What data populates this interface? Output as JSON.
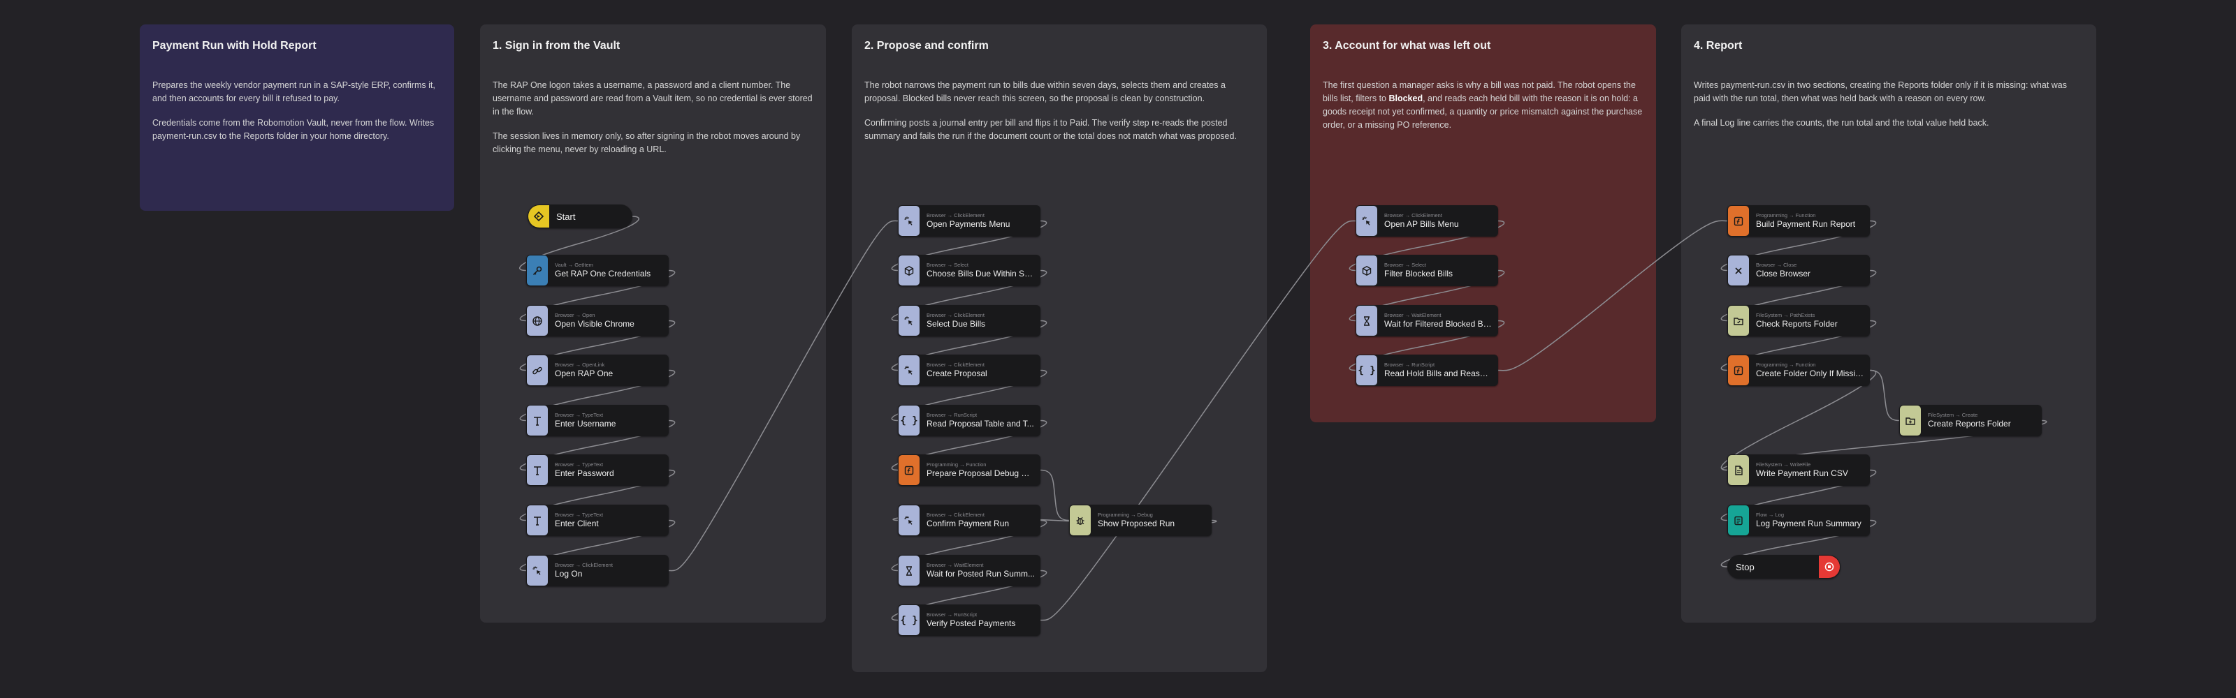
{
  "panels": {
    "intro": {
      "title": "Payment Run with Hold Report",
      "p1": "Prepares the weekly vendor payment run in a SAP-style ERP, confirms it, and then accounts for every bill it refused to pay.",
      "p2": "Credentials come from the Robomotion Vault, never from the flow. Writes payment-run.csv to the Reports folder in your home directory."
    },
    "sign_in": {
      "title": "1. Sign in from the Vault",
      "p1": "The RAP One logon takes a username, a password and a client number. The username and password are read from a Vault item, so no credential is ever stored in the flow.",
      "p2": "The session lives in memory only, so after signing in the robot moves around by clicking the menu, never by reloading a URL."
    },
    "propose": {
      "title": "2. Propose and confirm",
      "p1": "The robot narrows the payment run to bills due within seven days, selects them and creates a proposal. Blocked bills never reach this screen, so the proposal is clean by construction.",
      "p2": "Confirming posts a journal entry per bill and flips it to Paid. The verify step re-reads the posted summary and fails the run if the document count or the total does not match what was proposed."
    },
    "account": {
      "title": "3. Account for what was left out",
      "p1_a": "The first question a manager asks is why a bill was not paid. The robot opens the bills list, filters to ",
      "p1_b": "Blocked",
      "p1_c": ", and reads each held bill with the reason it is on hold: a goods receipt not yet confirmed, a quantity or price mismatch against the purchase order, or a missing PO reference."
    },
    "report": {
      "title": "4. Report",
      "p1": "Writes payment-run.csv in two sections, creating the Reports folder only if it is missing: what was paid with the run total, then what was held back with a reason on every row.",
      "p2": "A final Log line carries the counts, the run total and the total value held back."
    }
  },
  "nodes": {
    "start": {
      "title": "Start",
      "icon": "start-icon"
    },
    "get_creds": {
      "sub": "Vault → GetItem",
      "title": "Get RAP One Credentials",
      "icon": "key-icon"
    },
    "open_chrome": {
      "sub": "Browser → Open",
      "title": "Open Visible Chrome",
      "icon": "globe-icon"
    },
    "open_rap": {
      "sub": "Browser → OpenLink",
      "title": "Open RAP One",
      "icon": "link-icon"
    },
    "enter_user": {
      "sub": "Browser → TypeText",
      "title": "Enter Username",
      "icon": "text-icon"
    },
    "enter_pass": {
      "sub": "Browser → TypeText",
      "title": "Enter Password",
      "icon": "text-icon"
    },
    "enter_client": {
      "sub": "Browser → TypeText",
      "title": "Enter Client",
      "icon": "text-icon"
    },
    "log_on": {
      "sub": "Browser → ClickElement",
      "title": "Log On",
      "icon": "click-icon"
    },
    "open_pay_menu": {
      "sub": "Browser → ClickElement",
      "title": "Open Payments Menu",
      "icon": "click-icon"
    },
    "choose_bills": {
      "sub": "Browser → Select",
      "title": "Choose Bills Due Within Se...",
      "icon": "cube-icon"
    },
    "select_due": {
      "sub": "Browser → ClickElement",
      "title": "Select Due Bills",
      "icon": "click-icon"
    },
    "create_proposal": {
      "sub": "Browser → ClickElement",
      "title": "Create Proposal",
      "icon": "click-icon"
    },
    "read_proposal": {
      "sub": "Browser → RunScript",
      "title": "Read Proposal Table and T...",
      "icon": "braces-icon"
    },
    "prep_debug": {
      "sub": "Programming → Function",
      "title": "Prepare Proposal Debug Data",
      "icon": "function-icon"
    },
    "confirm_run": {
      "sub": "Browser → ClickElement",
      "title": "Confirm Payment Run",
      "icon": "click-icon"
    },
    "wait_posted": {
      "sub": "Browser → WaitElement",
      "title": "Wait for Posted Run Summ...",
      "icon": "hourglass-icon"
    },
    "verify_posted": {
      "sub": "Browser → RunScript",
      "title": "Verify Posted Payments",
      "icon": "braces-icon"
    },
    "show_proposed": {
      "sub": "Programming → Debug",
      "title": "Show Proposed Run",
      "icon": "bug-icon"
    },
    "open_ap": {
      "sub": "Browser → ClickElement",
      "title": "Open AP Bills Menu",
      "icon": "click-icon"
    },
    "filter_blocked": {
      "sub": "Browser → Select",
      "title": "Filter Blocked Bills",
      "icon": "cube-icon"
    },
    "wait_filtered": {
      "sub": "Browser → WaitElement",
      "title": "Wait for Filtered Blocked Bills",
      "icon": "hourglass-icon"
    },
    "read_hold": {
      "sub": "Browser → RunScript",
      "title": "Read Hold Bills and Reasons",
      "icon": "braces-icon"
    },
    "build_report": {
      "sub": "Programming → Function",
      "title": "Build Payment Run Report",
      "icon": "function-icon"
    },
    "close_browser": {
      "sub": "Browser → Close",
      "title": "Close Browser",
      "icon": "close-icon"
    },
    "check_folder": {
      "sub": "FileSystem → PathExists",
      "title": "Check Reports Folder",
      "icon": "folder-icon"
    },
    "create_if_missing": {
      "sub": "Programming → Function",
      "title": "Create Folder Only If Missing",
      "icon": "function-icon"
    },
    "create_folder": {
      "sub": "FileSystem → Create",
      "title": "Create Reports Folder",
      "icon": "folder-plus-icon"
    },
    "write_csv": {
      "sub": "FileSystem → WriteFile",
      "title": "Write Payment Run CSV",
      "icon": "file-icon"
    },
    "log_summary": {
      "sub": "Flow → Log",
      "title": "Log Payment Run Summary",
      "icon": "log-icon"
    },
    "stop": {
      "title": "Stop",
      "icon": "stop-icon"
    }
  }
}
